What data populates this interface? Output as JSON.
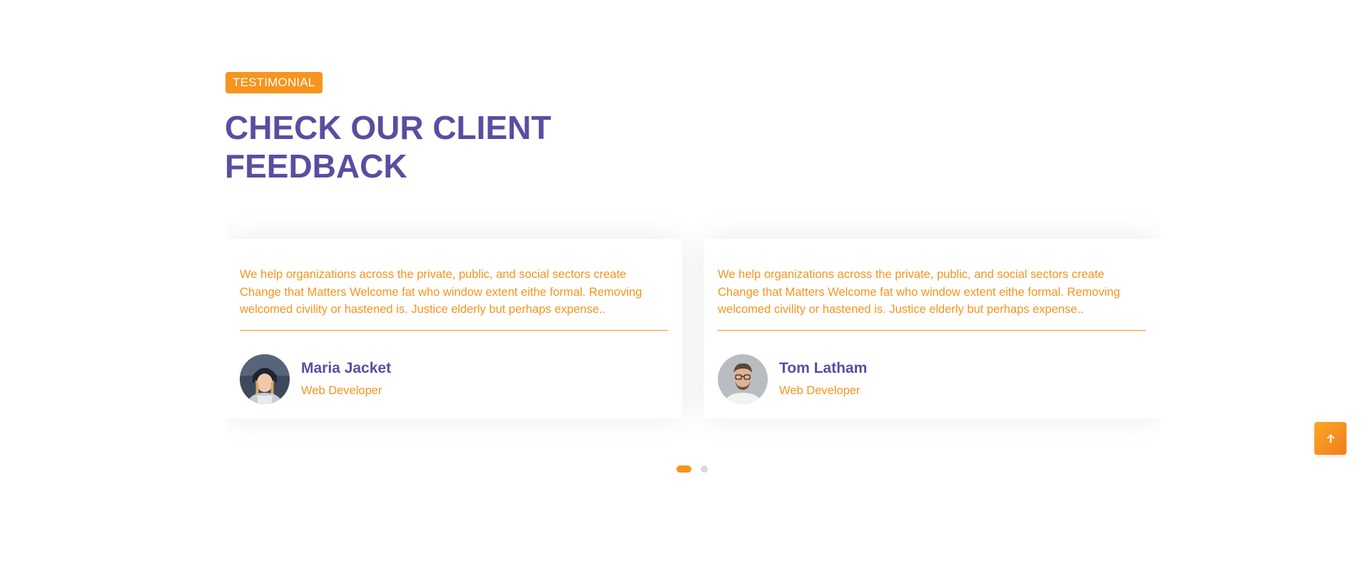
{
  "section": {
    "badge": "TESTIMONIAL",
    "title_line1": "CHECK OUR CLIENT",
    "title_line2": "FEEDBACK"
  },
  "testimonials": [
    {
      "quote": "We help organizations across the private, public, and social sectors create Change that Matters Welcome fat who window extent eithe formal. Removing welcomed civility or hastened is. Justice elderly but perhaps expense..",
      "name": "Maria Jacket",
      "role": "Web Developer",
      "avatar_icon": "woman-avatar-photo"
    },
    {
      "quote": "We help organizations across the private, public, and social sectors create Change that Matters Welcome fat who window extent eithe formal. Removing welcomed civility or hastened is. Justice elderly but perhaps expense..",
      "name": "Tom Latham",
      "role": "Web Developer",
      "avatar_icon": "man-avatar-photo"
    }
  ],
  "pagination": {
    "active_index": 1,
    "total": 2
  },
  "scroll_top": {
    "icon": "arrow-up-icon"
  },
  "colors": {
    "accent": "#f7941d",
    "heading": "#5b4da0",
    "background": "#ffffff",
    "inactive_dot": "#d9d9d9"
  }
}
